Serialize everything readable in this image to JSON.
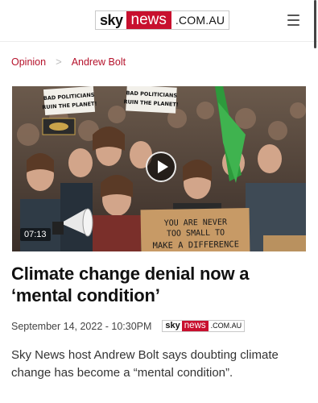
{
  "header": {
    "logo": {
      "sky": "sky",
      "news": "news",
      "domain": ".COM.AU"
    },
    "menu_icon": "hamburger-menu-icon"
  },
  "breadcrumb": {
    "items": [
      {
        "label": "Opinion"
      },
      {
        "label": "Andrew Bolt"
      }
    ],
    "separator": ">"
  },
  "hero": {
    "duration": "07:13",
    "play_icon": "play-icon",
    "signs": {
      "left": [
        "BAD POLITICIANS",
        "RUIN THE PLANET!"
      ],
      "right": [
        "BAD POLITICIANS",
        "RUIN THE PLANET!"
      ],
      "bottom": [
        "YOU ARE NEVER",
        "TOO SMALL TO",
        "MAKE A DIFFERENCE"
      ]
    }
  },
  "article": {
    "headline": "Climate change denial now a ‘mental condition’",
    "date": "September 14, 2022 - 10:30PM",
    "summary": "Sky News host Andrew Bolt says doubting climate change has become a “mental condition”."
  },
  "colors": {
    "brand_red": "#c8102e",
    "link_red": "#b5122b"
  }
}
